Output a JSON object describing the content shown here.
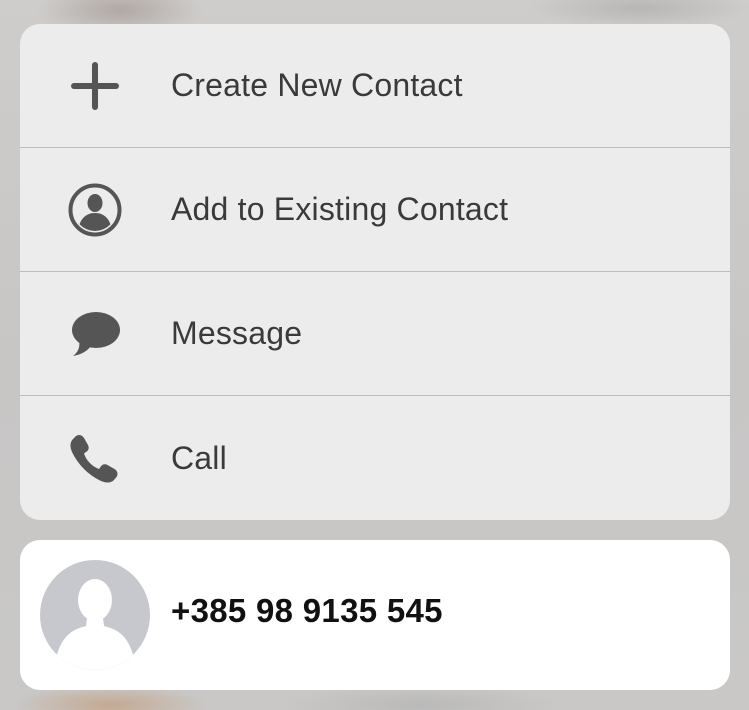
{
  "menu": {
    "items": [
      {
        "label": "Create New Contact",
        "icon": "plus-icon"
      },
      {
        "label": "Add to Existing Contact",
        "icon": "person-circle-icon"
      },
      {
        "label": "Message",
        "icon": "speech-bubble-icon"
      },
      {
        "label": "Call",
        "icon": "phone-icon"
      }
    ]
  },
  "contact": {
    "number": "+385 98 9135 545",
    "avatar_icon": "person-silhouette-icon"
  },
  "colors": {
    "menu_background": "#eeedee",
    "icon_color": "#555555",
    "text_color": "#3a3a3a",
    "avatar_background": "#c7c8cd"
  }
}
